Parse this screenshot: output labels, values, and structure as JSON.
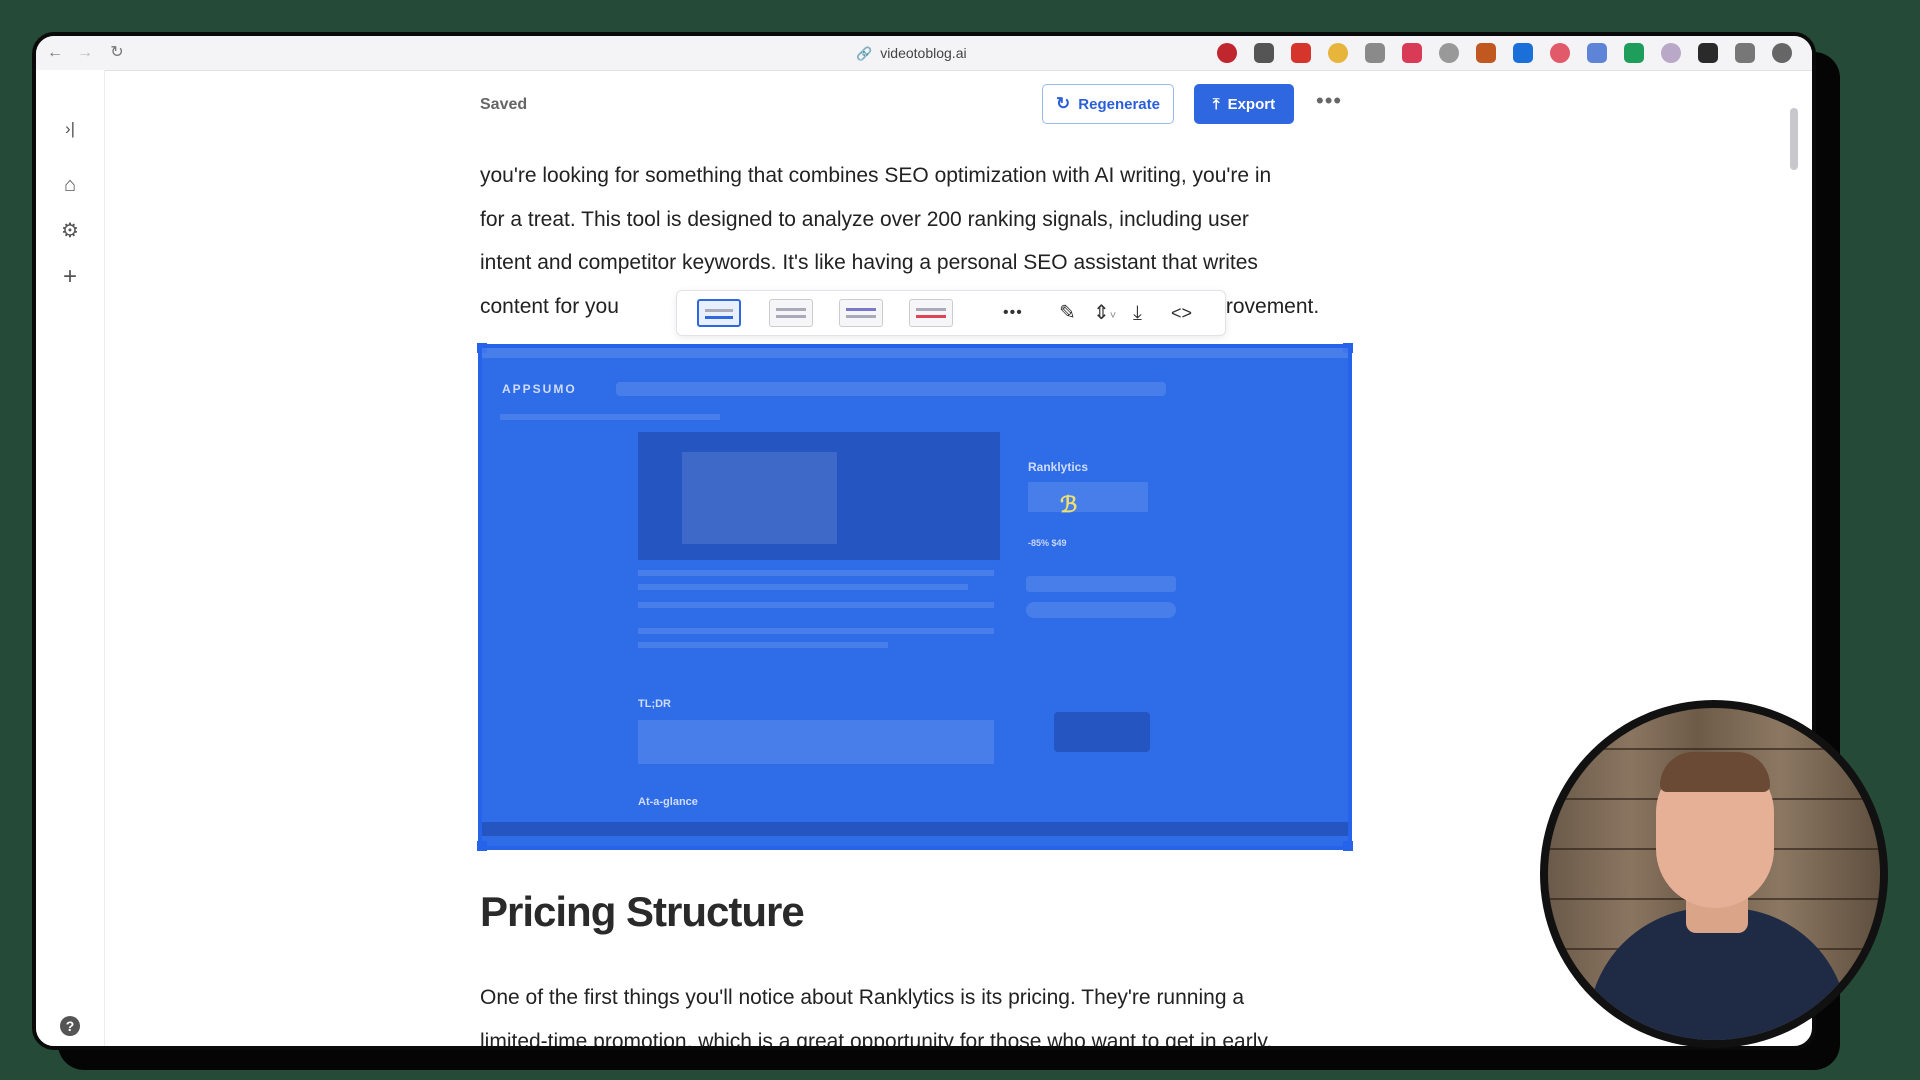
{
  "browser": {
    "url": "videotoblog.ai",
    "extension_colors": [
      "#c0262e",
      "#555555",
      "#d6352b",
      "#e7b53c",
      "#8a8a8a",
      "#d93a55",
      "#999999",
      "#c0581f",
      "#1b6fd8",
      "#e05a6a",
      "#5d84d6",
      "#1e9e5a",
      "#b9a8c8",
      "#2a2a2a",
      "#777777",
      "#666666"
    ]
  },
  "header": {
    "saved_label": "Saved",
    "regenerate_label": "Regenerate",
    "export_label": "Export"
  },
  "article": {
    "para1_lines": [
      "you're looking for something that combines SEO optimization with AI writing, you're in",
      "for a treat. This tool is designed to analyze over 200 ranking signals, including user",
      "intent and competitor keywords. It's like having a personal SEO assistant that writes"
    ],
    "para1_last_left": "content for you",
    "para1_last_right": "improvement.",
    "heading": "Pricing Structure",
    "para2_lines": [
      "One of the first things you'll notice about Ranklytics is its pricing. They're running a",
      "limited-time promotion, which is a great opportunity for those who want to get in early."
    ]
  },
  "embedded_image": {
    "logo": "APPSUMO",
    "product": "Ranklytics",
    "price": "-85% $49",
    "section1": "TL;DR",
    "section2": "At-a-glance"
  },
  "accent_color": "#2e67e0"
}
